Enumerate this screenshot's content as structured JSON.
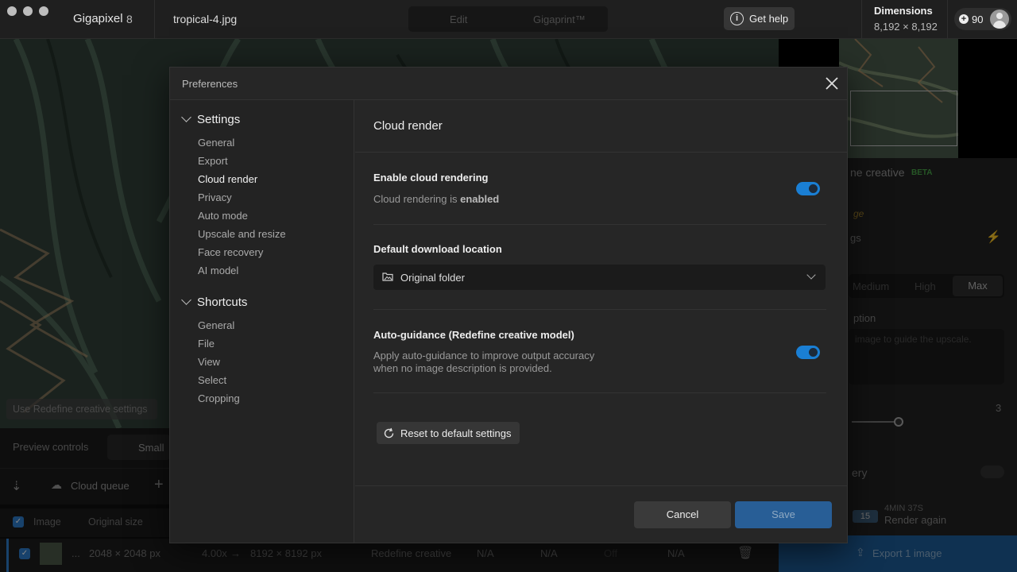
{
  "titlebar": {
    "app_name": "Gigapixel",
    "app_version": "8",
    "file_name": "tropical-4.jpg",
    "mode_tabs": [
      "Edit",
      "Gigaprint™"
    ],
    "help_label": "Get help",
    "dimensions_label": "Dimensions",
    "dimensions_value": "8,192 × 8,192",
    "credits": "90"
  },
  "background": {
    "use_redefine_settings": "Use Redefine creative settings",
    "preview_controls_label": "Preview controls",
    "preview_size": "Small",
    "cloud_queue_label": "Cloud queue",
    "table_headers": {
      "image": "Image",
      "original_size": "Original size"
    },
    "row": {
      "name": "...",
      "original_size": "2048 × 2048 px",
      "scale": "4.00x",
      "arrow": "→",
      "output_size": "8192 × 8192 px",
      "model": "Redefine creative",
      "col_a": "N/A",
      "col_b": "N/A",
      "col_c": "Off",
      "col_d": "N/A"
    }
  },
  "right_panel": {
    "model_title": "ne creative",
    "beta": "BETA",
    "ge_text": "ge",
    "gs_text": "gs",
    "quality_options": [
      "Medium",
      "High",
      "Max"
    ],
    "quality_selected": "Max",
    "description_label": "ption",
    "description_placeholder": "image to guide the upscale.",
    "slider_value": "3",
    "recovery_label": "ery",
    "credit_badge": "15",
    "render_time": "4MIN 37S",
    "render_again": "Render again",
    "export_label": "Export 1 image"
  },
  "preferences": {
    "title": "Preferences",
    "sections": [
      {
        "name": "Settings",
        "items": [
          "General",
          "Export",
          "Cloud render",
          "Privacy",
          "Auto mode",
          "Upscale and resize",
          "Face recovery",
          "AI model"
        ]
      },
      {
        "name": "Shortcuts",
        "items": [
          "General",
          "File",
          "View",
          "Select",
          "Cropping"
        ]
      }
    ],
    "active_item": "Cloud render",
    "content": {
      "title": "Cloud render",
      "cloud_rendering": {
        "title": "Enable cloud rendering",
        "status_prefix": "Cloud rendering is ",
        "status_value": "enabled",
        "enabled": true
      },
      "download_location": {
        "title": "Default download location",
        "value": "Original folder"
      },
      "auto_guidance": {
        "title": "Auto-guidance (Redefine creative model)",
        "description": "Apply auto-guidance to improve output accuracy when no image description is provided.",
        "enabled": true
      },
      "reset_label": "Reset to default settings"
    },
    "footer": {
      "cancel": "Cancel",
      "save": "Save"
    }
  },
  "colors": {
    "accent": "#1a7fd4",
    "save_button": "#285e96",
    "beta": "#4aa84a"
  },
  "icons": {
    "close": "close-icon",
    "help": "info-icon",
    "folder": "folder-image-icon",
    "reset": "reset-icon",
    "chevron": "chevron-down-icon"
  }
}
